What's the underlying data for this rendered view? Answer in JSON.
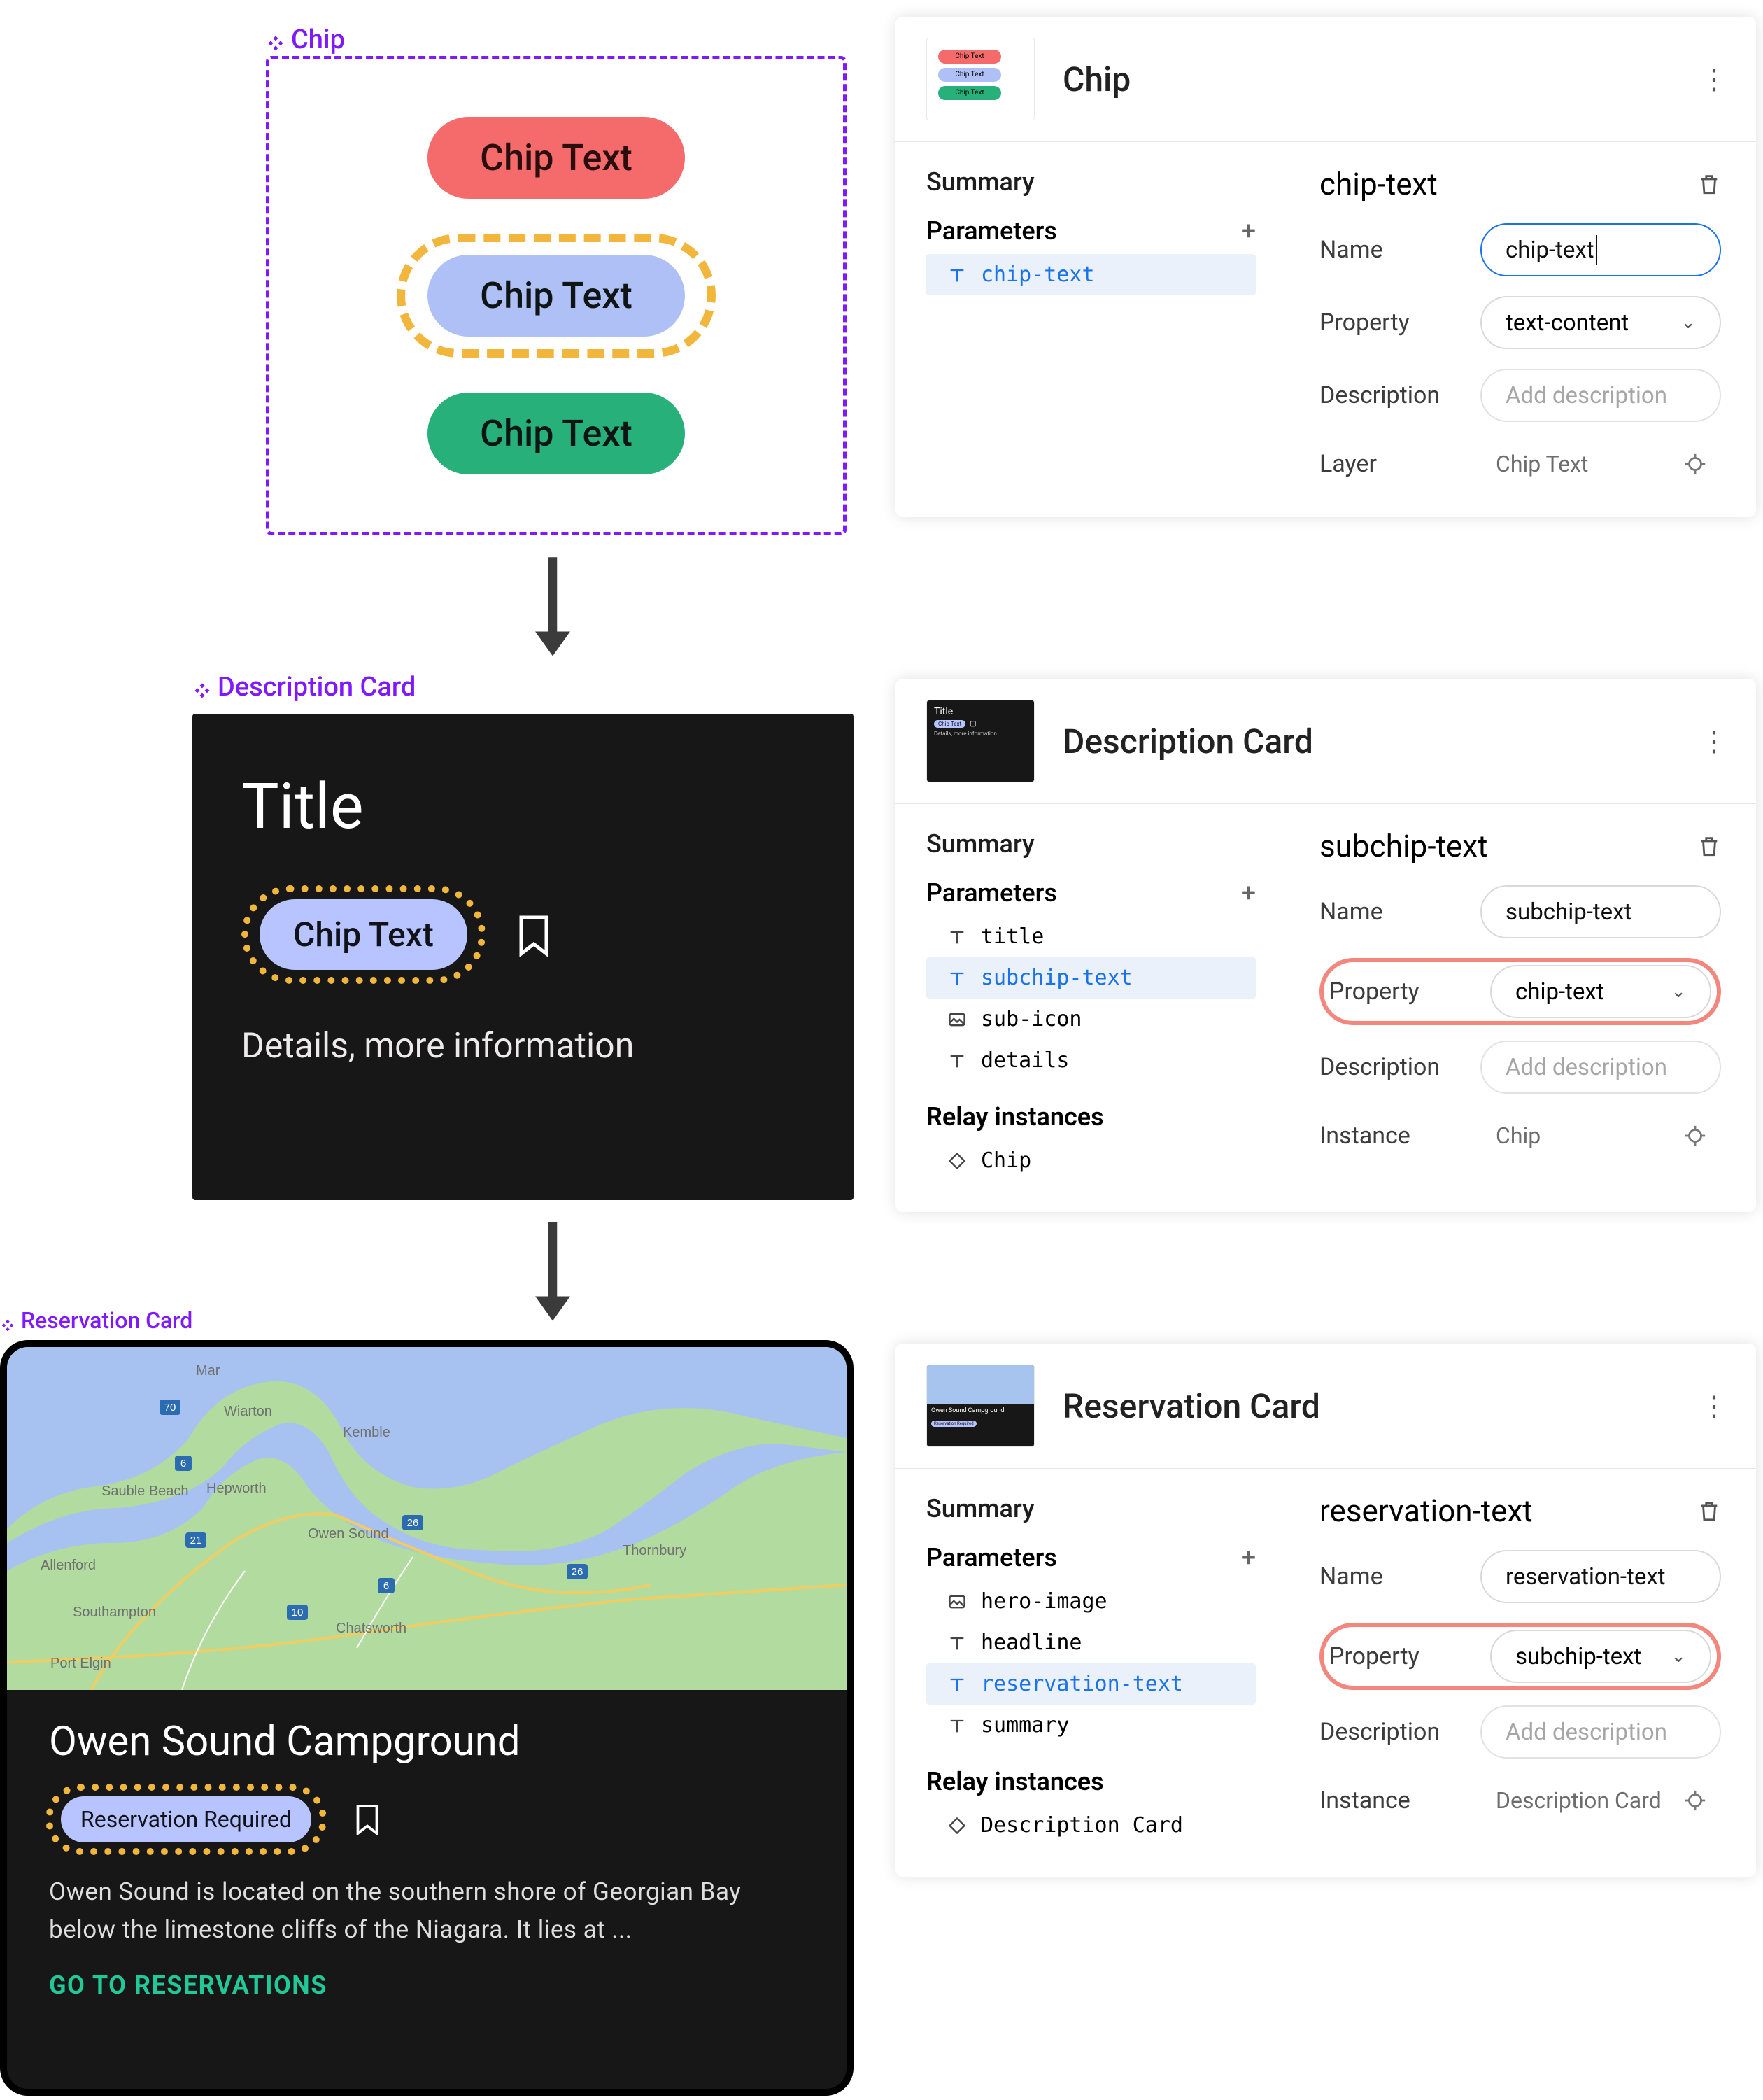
{
  "left": {
    "chip_label": "Chip",
    "chip_texts": [
      "Chip Text",
      "Chip Text",
      "Chip Text"
    ],
    "desc_label": "Description Card",
    "desc": {
      "title": "Title",
      "chip_text": "Chip Text",
      "details": "Details, more information"
    },
    "res_label": "Reservation Card",
    "res": {
      "headline": "Owen Sound Campground",
      "chip_text": "Reservation Required",
      "summary": "Owen Sound is located on the southern shore of Georgian Bay below the limestone cliffs of the Niagara. It lies at ...",
      "cta": "GO TO RESERVATIONS",
      "map_labels": [
        "Allenford",
        "Mar",
        "Wiarton",
        "Kemble",
        "Hepworth",
        "Sauble Beach",
        "Owen Sound",
        "Southampton",
        "Chatsworth",
        "Port Elgin",
        "Thornbury"
      ],
      "map_roads": [
        "70",
        "26",
        "21",
        "10",
        "6"
      ]
    }
  },
  "panels": {
    "chip": {
      "title": "Chip",
      "summary_label": "Summary",
      "parameters_label": "Parameters",
      "params": [
        {
          "name": "chip-text",
          "icon": "T",
          "selected": true
        }
      ],
      "detail": {
        "heading": "chip-text",
        "name_label": "Name",
        "name_value": "chip-text",
        "property_label": "Property",
        "property_value": "text-content",
        "description_label": "Description",
        "description_placeholder": "Add description",
        "layer_label": "Layer",
        "layer_value": "Chip Text"
      }
    },
    "desc": {
      "title": "Description Card",
      "summary_label": "Summary",
      "parameters_label": "Parameters",
      "relay_label": "Relay instances",
      "params": [
        {
          "name": "title",
          "icon": "T"
        },
        {
          "name": "subchip-text",
          "icon": "T",
          "selected": true
        },
        {
          "name": "sub-icon",
          "icon": "img"
        },
        {
          "name": "details",
          "icon": "T"
        }
      ],
      "relays": [
        {
          "name": "Chip",
          "icon": "diamond"
        }
      ],
      "detail": {
        "heading": "subchip-text",
        "name_label": "Name",
        "name_value": "subchip-text",
        "property_label": "Property",
        "property_value": "chip-text",
        "description_label": "Description",
        "description_placeholder": "Add description",
        "instance_label": "Instance",
        "instance_value": "Chip"
      }
    },
    "res": {
      "title": "Reservation Card",
      "summary_label": "Summary",
      "parameters_label": "Parameters",
      "relay_label": "Relay instances",
      "params": [
        {
          "name": "hero-image",
          "icon": "img"
        },
        {
          "name": "headline",
          "icon": "T"
        },
        {
          "name": "reservation-text",
          "icon": "T",
          "selected": true
        },
        {
          "name": "summary",
          "icon": "T"
        }
      ],
      "relays": [
        {
          "name": "Description Card",
          "icon": "diamond"
        }
      ],
      "detail": {
        "heading": "reservation-text",
        "name_label": "Name",
        "name_value": "reservation-text",
        "property_label": "Property",
        "property_value": "subchip-text",
        "description_label": "Description",
        "description_placeholder": "Add description",
        "instance_label": "Instance",
        "instance_value": "Description Card"
      }
    }
  }
}
